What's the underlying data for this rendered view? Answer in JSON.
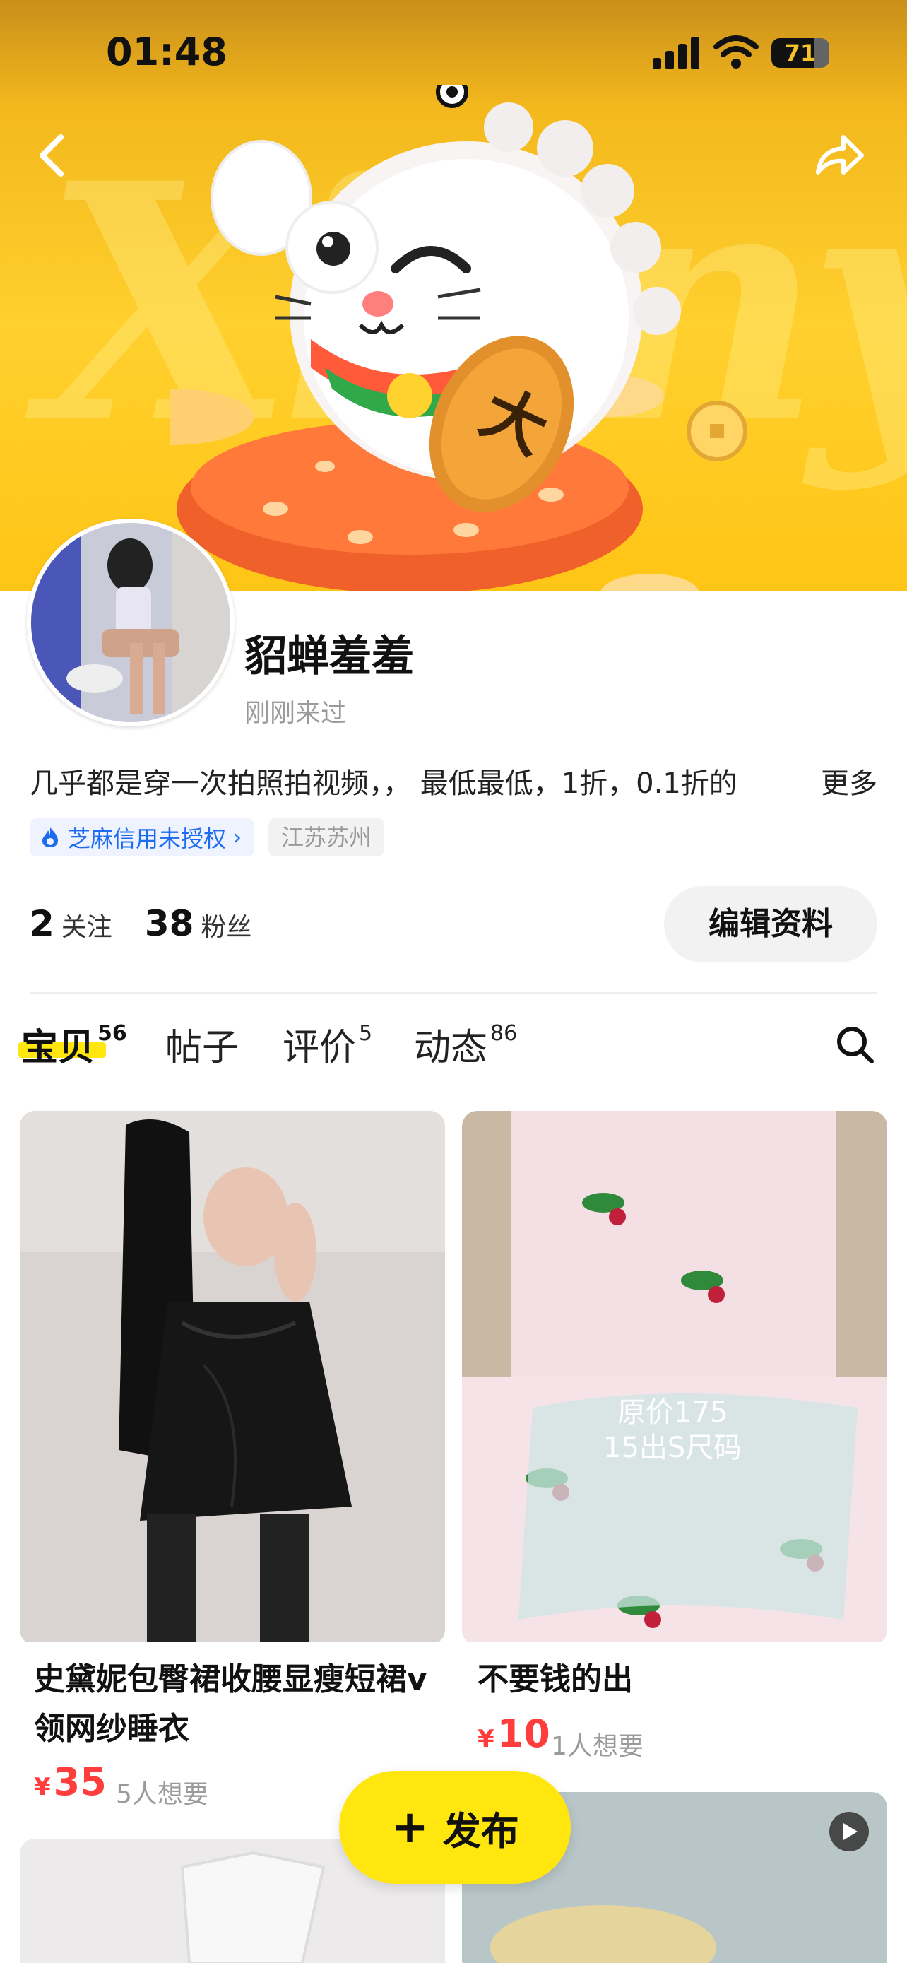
{
  "status_bar": {
    "time": "01:48",
    "battery": "71"
  },
  "banner_text": "Xianyu",
  "profile": {
    "name": "貂蝉羞羞",
    "last_seen": "刚刚来过",
    "bio": "几乎都是穿一次拍照拍视频，，  最低最低，1折，0.1折的",
    "bio_more": "更多",
    "credit_badge": "芝麻信用未授权",
    "location": "江苏苏州",
    "following_count": "2",
    "following_label": "关注",
    "followers_count": "38",
    "followers_label": "粉丝",
    "edit_button": "编辑资料"
  },
  "tabs": [
    {
      "label": "宝贝",
      "count": "56",
      "active": true
    },
    {
      "label": "帖子",
      "count": ""
    },
    {
      "label": "评价",
      "count": "5"
    },
    {
      "label": "动态",
      "count": "86"
    }
  ],
  "products": [
    {
      "title": "史黛妮包臀裙收腰显瘦短裙v领网纱睡衣",
      "price": "35",
      "wants": "5人想要"
    },
    {
      "title": "不要钱的出",
      "price": "10",
      "wants": "1人想要",
      "image_overlay": "原价175\n15出S尺码"
    }
  ],
  "currency": "¥",
  "publish_button": "发布",
  "colors": {
    "accent": "#ffe60f",
    "price": "#ff3d3d",
    "link": "#1d6cf0"
  }
}
